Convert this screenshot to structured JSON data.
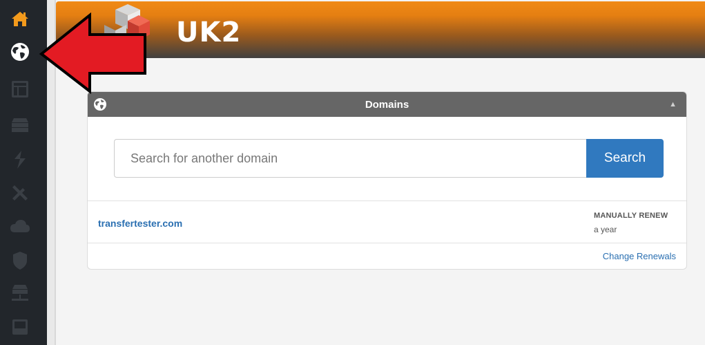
{
  "sidebar": {
    "items": [
      {
        "icon": "home-icon",
        "active": true
      },
      {
        "icon": "globe-icon",
        "active": false
      },
      {
        "icon": "layout-icon",
        "active": false
      },
      {
        "icon": "server-stack-icon",
        "active": false
      },
      {
        "icon": "ssl-icon",
        "active": false
      },
      {
        "icon": "tools-icon",
        "active": false
      },
      {
        "icon": "cloud-icon",
        "active": false
      },
      {
        "icon": "shield-icon",
        "active": false
      },
      {
        "icon": "network-server-icon",
        "active": false
      },
      {
        "icon": "drive-icon",
        "active": false
      }
    ]
  },
  "header": {
    "logo_text": "UK2"
  },
  "panel": {
    "title": "Domains",
    "search": {
      "placeholder": "Search for another domain",
      "button_label": "Search"
    },
    "domains": [
      {
        "name": "transfertester.com",
        "renewal_status": "MANUALLY RENEW",
        "renewal_period": "a year"
      }
    ],
    "change_renewals_label": "Change Renewals"
  },
  "colors": {
    "sidebar_bg": "#22262b",
    "header_orange": "#f08a16",
    "panel_header": "#666666",
    "primary_button": "#3079bf",
    "link": "#2a6fb1",
    "annotation_arrow": "#e31b23"
  }
}
